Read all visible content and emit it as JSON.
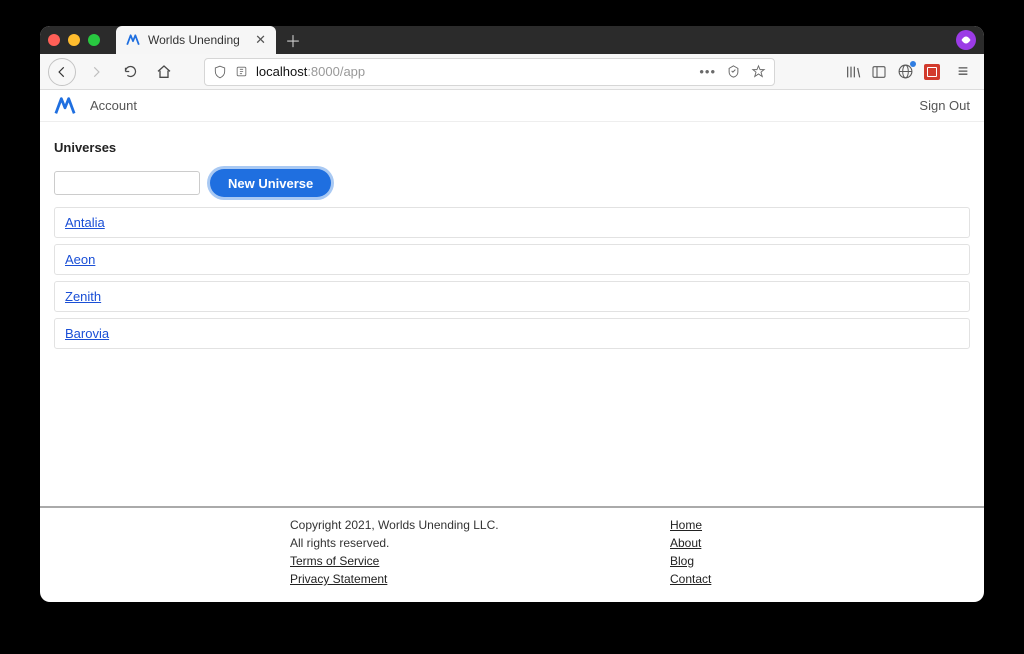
{
  "browser": {
    "tab_title": "Worlds Unending",
    "url_prefix": "localhost",
    "url_rest": ":8000/app"
  },
  "header": {
    "account": "Account",
    "signout": "Sign Out"
  },
  "main": {
    "heading": "Universes",
    "new_button": "New Universe",
    "universes": [
      "Antalia",
      "Aeon",
      "Zenith",
      "Barovia"
    ]
  },
  "footer": {
    "copyright": "Copyright 2021, Worlds Unending LLC.",
    "rights": "All rights reserved.",
    "tos": "Terms of Service",
    "privacy": "Privacy Statement",
    "links": {
      "home": "Home",
      "about": "About",
      "blog": "Blog",
      "contact": "Contact"
    }
  }
}
